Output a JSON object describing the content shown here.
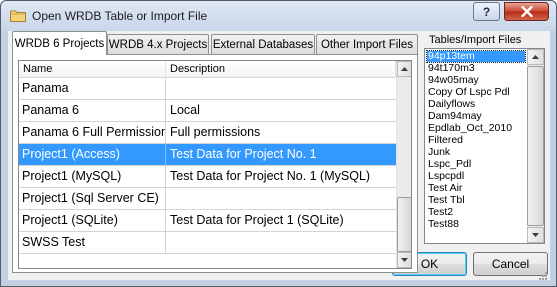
{
  "window": {
    "title": "Open WRDB Table or Import File",
    "help_label": "?",
    "close_label": "✕",
    "accent": "#3399ff",
    "close_color": "#c9442b"
  },
  "tabs": [
    {
      "label": "WRDB 6 Projects",
      "active": true
    },
    {
      "label": "WRDB 4.x Projects",
      "active": false
    },
    {
      "label": "External Databases",
      "active": false
    },
    {
      "label": "Other Import Files",
      "active": false
    }
  ],
  "grid": {
    "columns": [
      "Name",
      "Description"
    ],
    "rows": [
      {
        "name": "Panama",
        "description": ""
      },
      {
        "name": "Panama 6",
        "description": "Local"
      },
      {
        "name": "Panama 6 Full Permissions",
        "description": "Full permissions"
      },
      {
        "name": "Project1 (Access)",
        "description": "Test Data for Project No. 1",
        "selected": true
      },
      {
        "name": "Project1 (MySQL)",
        "description": "Test Data for Project No. 1 (MySQL)"
      },
      {
        "name": "Project1 (Sql Server CE)",
        "description": ""
      },
      {
        "name": "Project1 (SQLite)",
        "description": "Test Data for Project 1 (SQLite)"
      },
      {
        "name": "SWSS Test",
        "description": ""
      }
    ]
  },
  "files": {
    "label": "Tables/Import Files",
    "items": [
      "94p13tem",
      "94t170m3",
      "94w05may",
      "Copy Of Lspc Pdl",
      "Dailyflows",
      "Dam94may",
      "Epdlab_Oct_2010",
      "Filtered",
      "Junk",
      "Lspc_Pdl",
      "Lspcpdl",
      "Test Air",
      "Test Tbl",
      "Test2",
      "Test88"
    ],
    "selected": "94p13tem"
  },
  "buttons": {
    "ok": "OK",
    "cancel": "Cancel"
  }
}
